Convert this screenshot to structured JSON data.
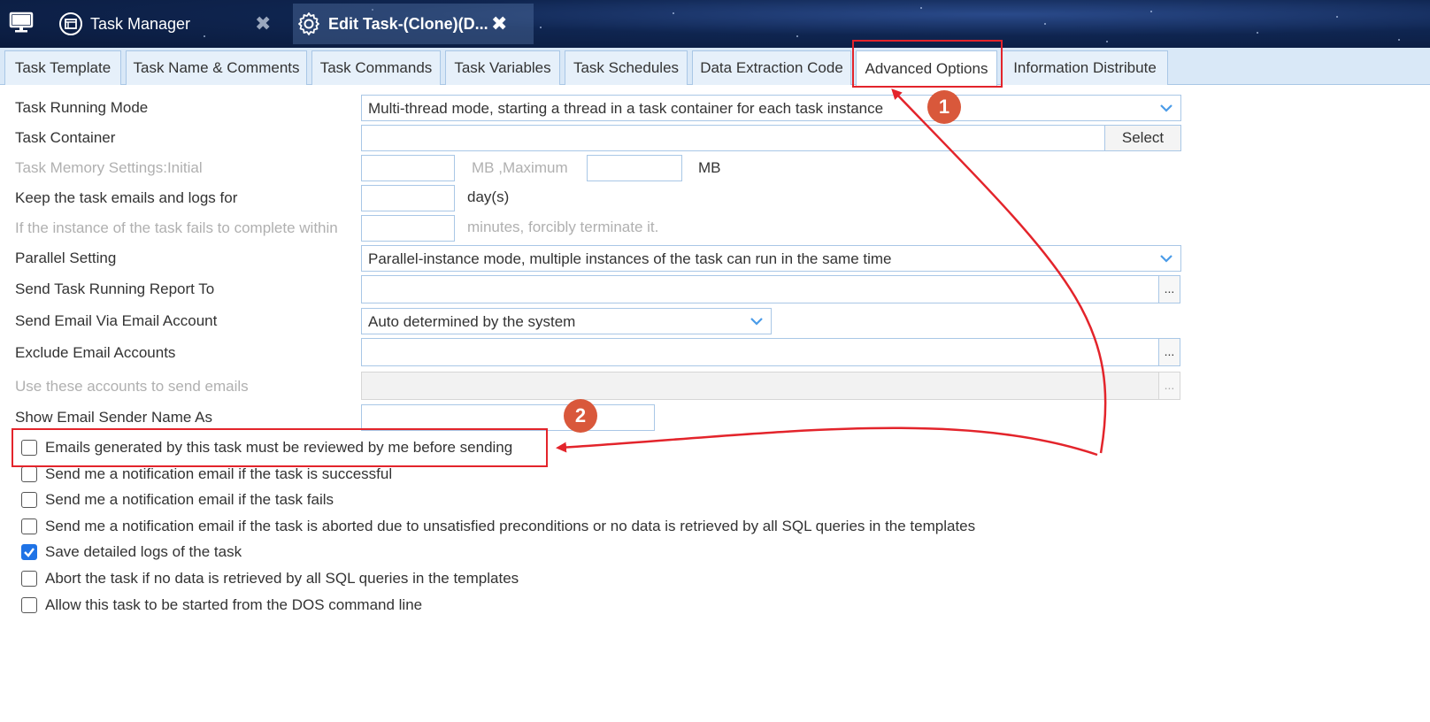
{
  "topbar": {
    "home_icon": "monitor-icon",
    "tabs": [
      {
        "label": "Task Manager",
        "icon": "task-manager-icon",
        "close": "✖"
      },
      {
        "label": "Edit Task-(Clone)(D...",
        "icon": "gear-icon",
        "close": "✖"
      }
    ]
  },
  "subtabs": [
    "Task Template",
    "Task Name & Comments",
    "Task Commands",
    "Task Variables",
    "Task Schedules",
    "Data Extraction Code",
    "Advanced Options",
    "Information Distribute"
  ],
  "active_subtab": "Advanced Options",
  "form": {
    "running_mode": {
      "label": "Task Running Mode",
      "value": "Multi-thread mode, starting a thread in a task container for each task instance"
    },
    "container": {
      "label": "Task Container",
      "value": "",
      "button": "Select"
    },
    "memory": {
      "label": "Task Memory Settings:Initial",
      "initial": "",
      "unit1": "MB ,Maximum",
      "maximum": "",
      "unit2": "MB"
    },
    "keep_logs": {
      "label": "Keep the task emails and logs for",
      "value": "",
      "unit": "day(s)"
    },
    "timeout": {
      "label": "If the instance of the task fails to complete within",
      "value": "",
      "unit": "minutes, forcibly terminate it."
    },
    "parallel": {
      "label": "Parallel Setting",
      "value": "Parallel-instance mode, multiple instances of the task can run in the same time"
    },
    "report_to": {
      "label": "Send Task Running Report To",
      "value": "",
      "button": "..."
    },
    "email_account": {
      "label": "Send Email Via Email Account",
      "value": "Auto determined by the system"
    },
    "exclude_accounts": {
      "label": "Exclude Email Accounts",
      "value": "",
      "button": "..."
    },
    "use_accounts": {
      "label": "Use these accounts to send emails",
      "value": "",
      "button": "..."
    },
    "sender_name": {
      "label": "Show Email Sender Name As",
      "value": ""
    }
  },
  "checkboxes": [
    {
      "label": "Emails generated by this task must be reviewed by me before sending",
      "checked": false
    },
    {
      "label": "Send me a notification email if the task is successful",
      "checked": false
    },
    {
      "label": "Send me a notification email if the task fails",
      "checked": false
    },
    {
      "label": "Send me a notification email if the task is aborted due to unsatisfied preconditions or no data is retrieved by all SQL queries in the templates",
      "checked": false
    },
    {
      "label": "Save detailed logs of the task",
      "checked": true
    },
    {
      "label": "Abort the task if no data is retrieved by all SQL queries in the templates",
      "checked": false
    },
    {
      "label": "Allow this task to be started from the DOS command line",
      "checked": false
    }
  ],
  "annotations": {
    "badge1": "1",
    "badge2": "2",
    "color": "#e3242b",
    "badge_color": "#d9583b"
  },
  "colors": {
    "accent": "#1f73e6",
    "tab_bg": "#d9e8f7",
    "border": "#a9c7e6"
  }
}
